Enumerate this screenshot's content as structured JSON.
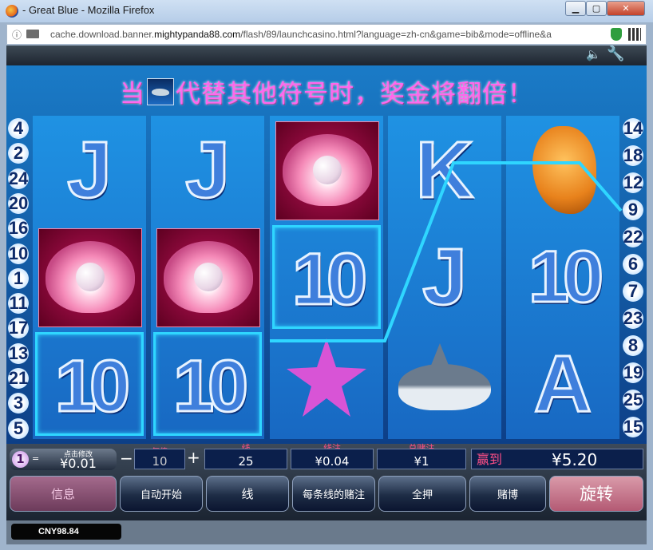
{
  "window": {
    "title": "- Great Blue - Mozilla Firefox",
    "url_prefix": "cache.download.banner.",
    "url_domain": "mightypanda88.com",
    "url_suffix": "/flash/89/launchcasino.html?language=zh-cn&game=bib&mode=offline&a"
  },
  "game": {
    "banner_before": "当",
    "banner_after": "代替其他符号时，奖金将翻倍！",
    "left_line_numbers": [
      "4",
      "2",
      "24",
      "20",
      "16",
      "10",
      "1",
      "11",
      "17",
      "13",
      "21",
      "3",
      "5"
    ],
    "right_line_numbers": [
      "14",
      "18",
      "12",
      "9",
      "22",
      "6",
      "7",
      "23",
      "8",
      "19",
      "25",
      "15"
    ],
    "reels": [
      [
        "J",
        "clam",
        "10"
      ],
      [
        "J",
        "clam",
        "10"
      ],
      [
        "clam",
        "10",
        "starfish"
      ],
      [
        "K",
        "J",
        "shark"
      ],
      [
        "seahorse",
        "10",
        "A"
      ]
    ],
    "win_line_color": "#2fd6ff"
  },
  "controls": {
    "coin_badge": "1",
    "coin_eq": "=",
    "coin_label": "点击修改",
    "coin_value": "¥0.01",
    "minus": "−",
    "plus": "+",
    "coins_per_line_label": "每倍",
    "coins_per_line": "10",
    "lines_label": "线",
    "lines": "25",
    "line_bet_label": "线注",
    "line_bet": "¥0.04",
    "total_bet_label": "总赌注",
    "total_bet": "¥1",
    "win_label": "赢到",
    "win_value": "¥5.20",
    "buttons": {
      "info": "信息",
      "autoplay": "自动开始",
      "lines": "线",
      "bet_per_line": "每条线的赌注",
      "bet_max": "全押",
      "gamble": "赌博",
      "spin": "旋转"
    },
    "balance": "CNY98.84"
  }
}
